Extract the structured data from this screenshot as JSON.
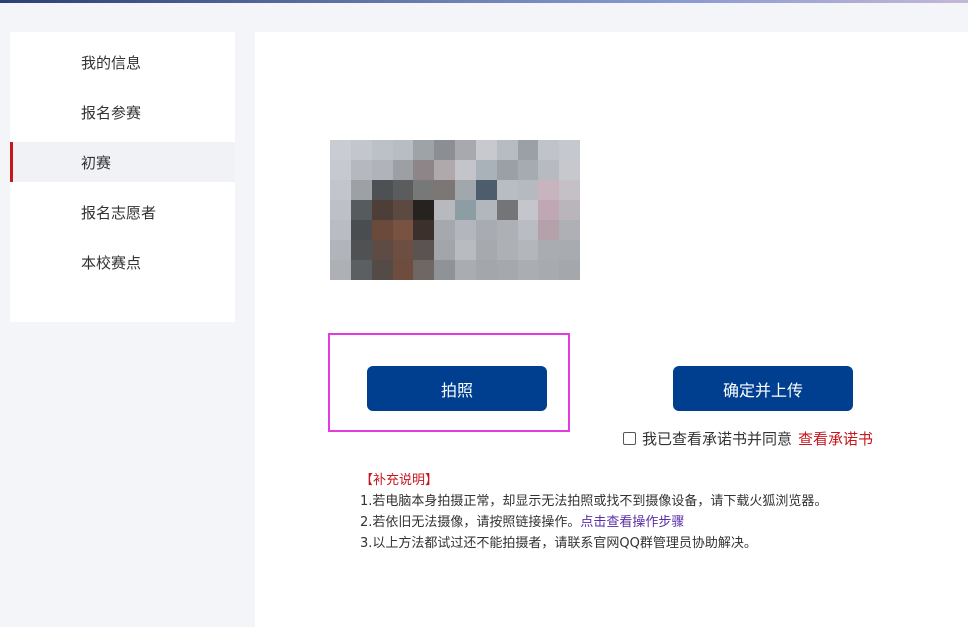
{
  "sidebar": {
    "items": [
      {
        "label": "我的信息",
        "active": false
      },
      {
        "label": "报名参赛",
        "active": false
      },
      {
        "label": "初赛",
        "active": true
      },
      {
        "label": "报名志愿者",
        "active": false
      },
      {
        "label": "本校赛点",
        "active": false
      }
    ]
  },
  "main": {
    "take_photo_label": "拍照",
    "confirm_upload_label": "确定并上传",
    "agree_text": "我已查看承诺书并同意",
    "agree_link": "查看承诺书",
    "notes": {
      "title": "【补充说明】",
      "line1": "1.若电脑本身拍摄正常，却显示无法拍照或找不到摄像设备，请下载火狐浏览器。",
      "line2_text": "2.若依旧无法摄像，请按照链接操作。",
      "line2_link": "点击查看操作步骤",
      "line3": "3.以上方法都试过还不能拍摄者，请联系官网QQ群管理员协助解决。"
    }
  },
  "colors": {
    "primary": "#003f8f",
    "accent_red": "#c8161d",
    "link_purple": "#5a2ea6",
    "highlight": "#e23be0"
  }
}
